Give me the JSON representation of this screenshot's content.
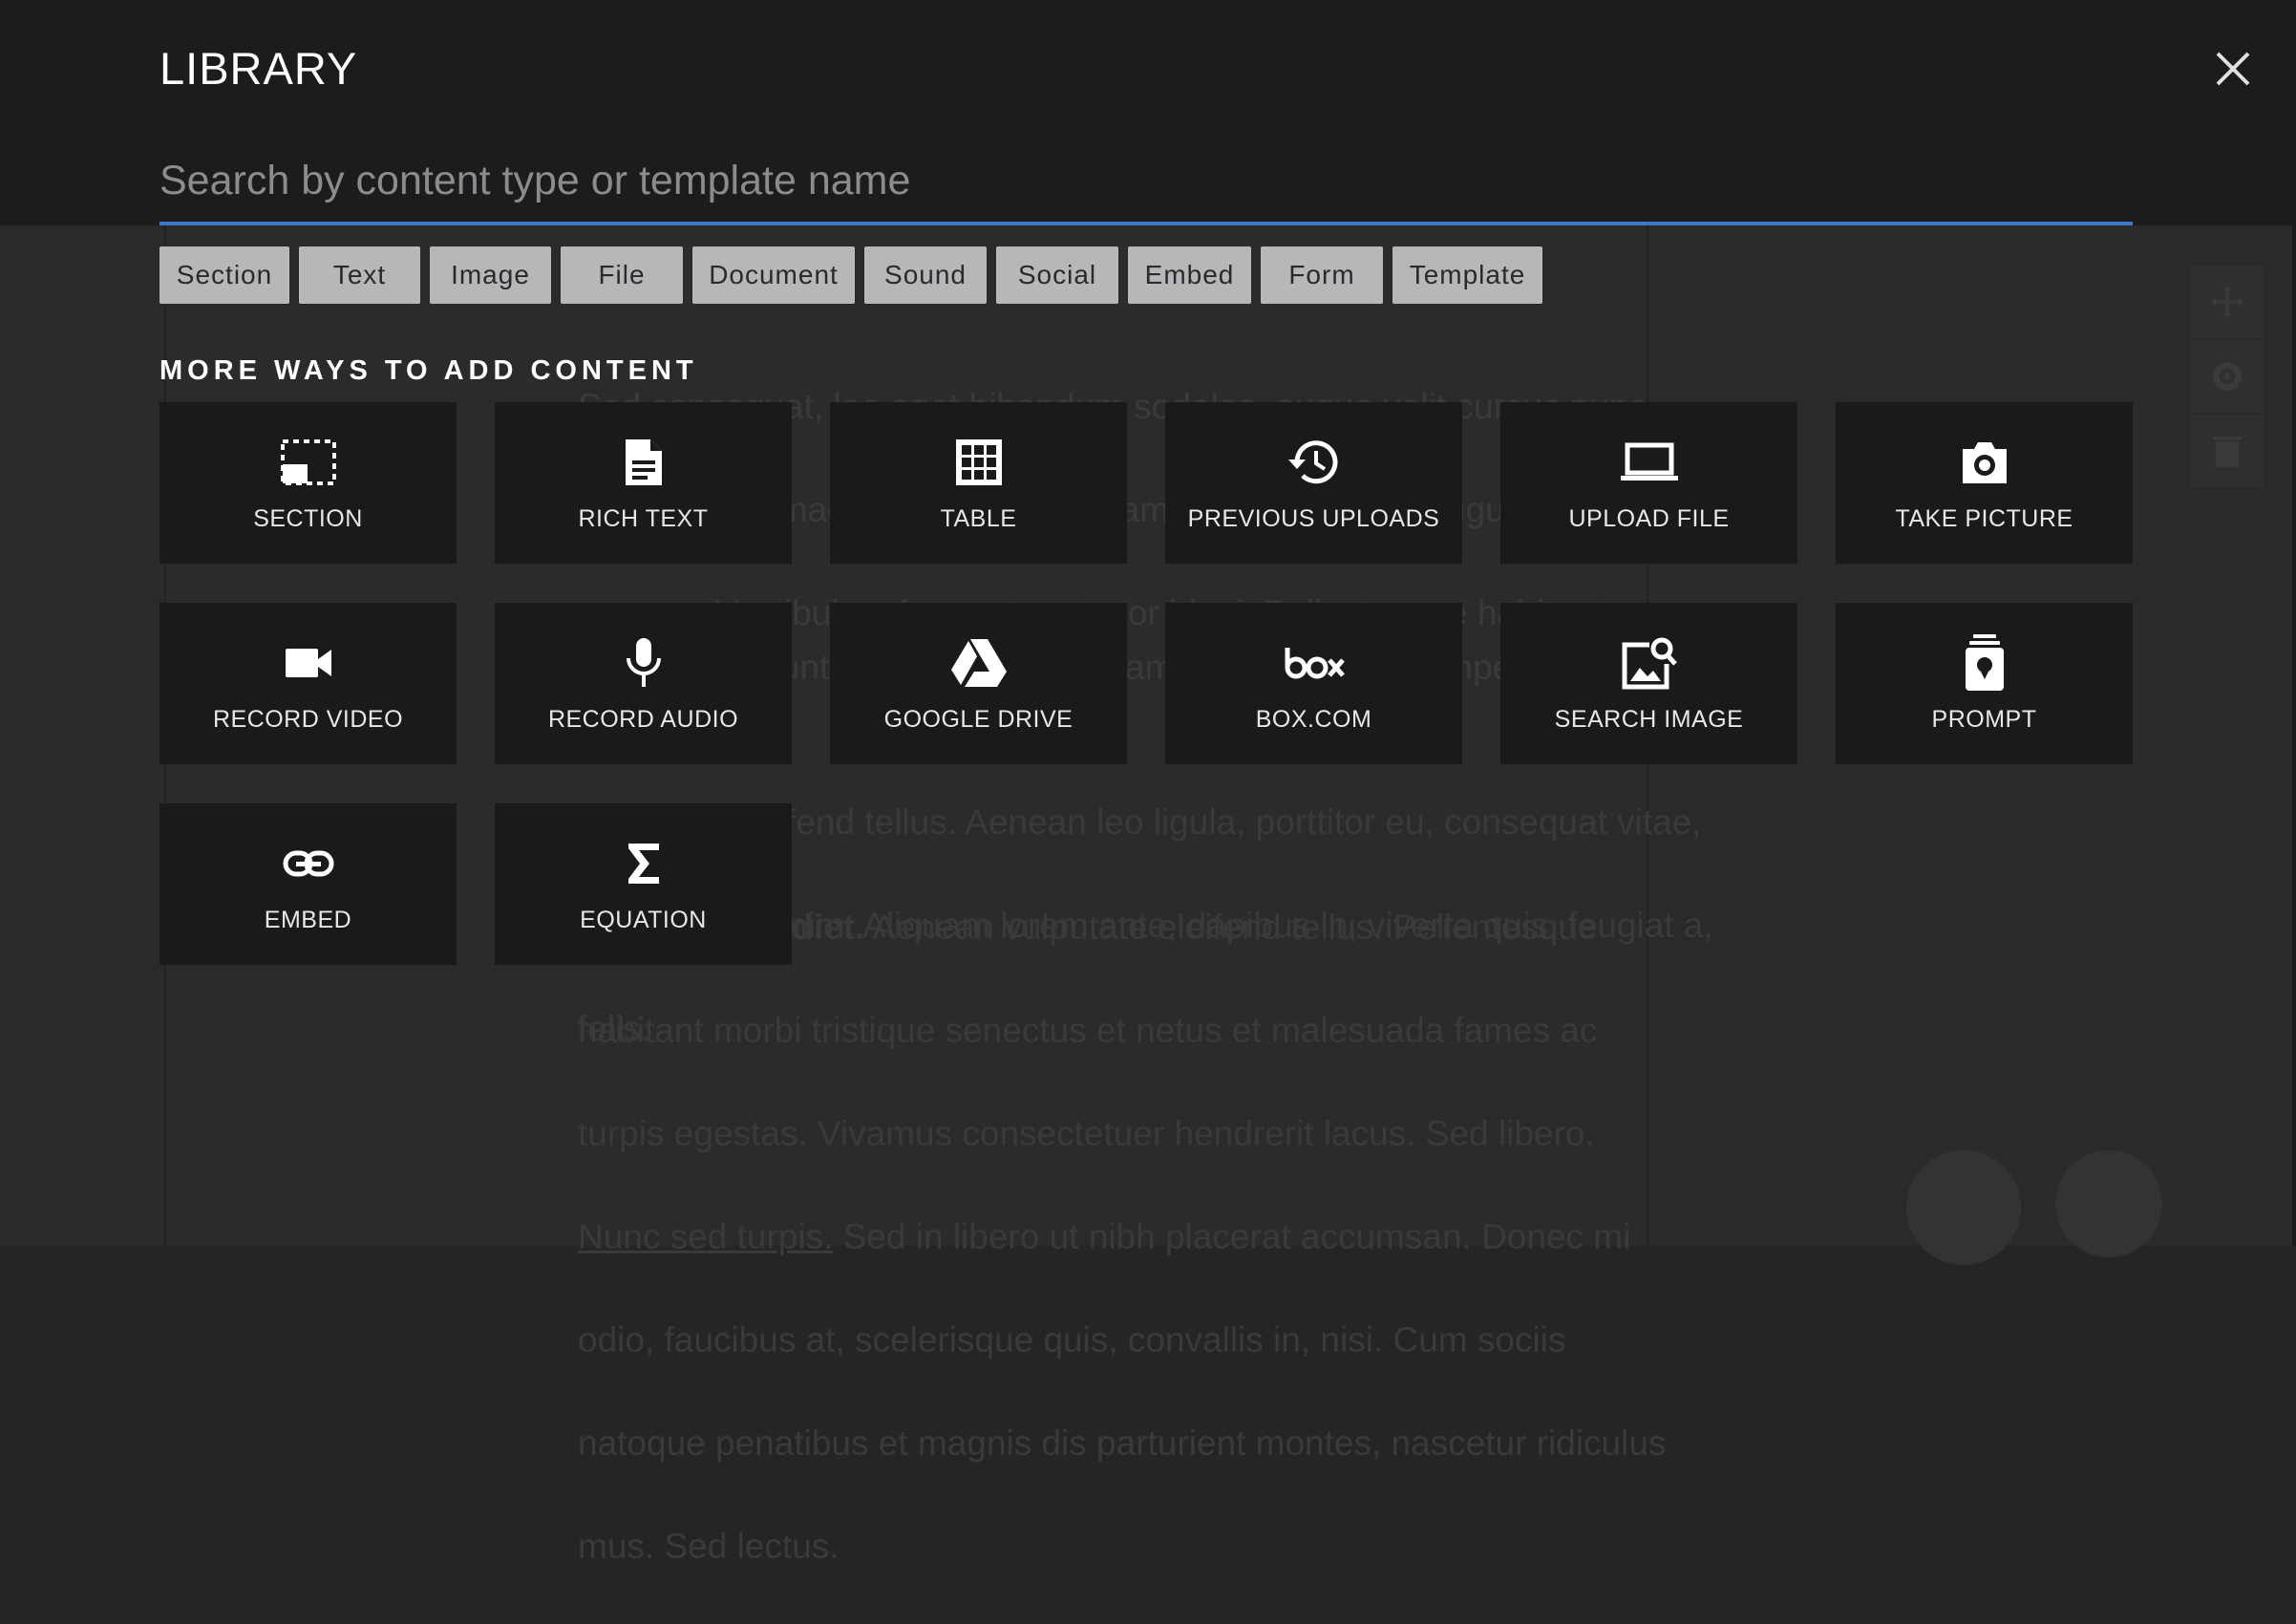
{
  "library": {
    "title": "LIBRARY",
    "search_placeholder": "Search by content type or template name",
    "close_icon": "close-icon"
  },
  "filters": [
    "Section",
    "Text",
    "Image",
    "File",
    "Document",
    "Sound",
    "Social",
    "Embed",
    "Form",
    "Template"
  ],
  "more_ways": {
    "heading": "MORE WAYS TO ADD CONTENT",
    "tiles": [
      {
        "label": "SECTION",
        "icon": "section-icon"
      },
      {
        "label": "RICH TEXT",
        "icon": "document-icon"
      },
      {
        "label": "TABLE",
        "icon": "table-icon"
      },
      {
        "label": "PREVIOUS UPLOADS",
        "icon": "history-icon"
      },
      {
        "label": "UPLOAD FILE",
        "icon": "laptop-icon"
      },
      {
        "label": "TAKE PICTURE",
        "icon": "camera-icon"
      },
      {
        "label": "RECORD VIDEO",
        "icon": "video-camera-icon"
      },
      {
        "label": "RECORD AUDIO",
        "icon": "microphone-icon"
      },
      {
        "label": "GOOGLE DRIVE",
        "icon": "google-drive-icon"
      },
      {
        "label": "BOX.COM",
        "icon": "box-logo-icon"
      },
      {
        "label": "SEARCH IMAGE",
        "icon": "image-search-icon"
      },
      {
        "label": "PROMPT",
        "icon": "prompt-icon"
      },
      {
        "label": "EMBED",
        "icon": "link-icon"
      },
      {
        "label": "EQUATION",
        "icon": "sigma-icon"
      }
    ]
  },
  "background_page": {
    "para1_lines": [
      "Sed consequat, leo eget bibendum sodales, augue velit cursus nunc,",
      "quis gravida magna mi a libero. Etiam ultricies nisi vel augue. Fusce",
      "a quam. Vestibulum fermentum tortor id mi. Pellentesque habitant"
    ],
    "para2_lines": [
      "Integer tincidunt. Cras dapibus. Vivamus elementum semper nisi. Aenean",
      "vulputate eleifend tellus. Aenean leo ligula, porttitor eu, consequat vitae,",
      "eleifend ac, enim. Aliquam lorem ante, dapibus in, viverra quis, feugiat a,",
      "felis."
    ],
    "bold_phrase": "Donec imperdiet.",
    "para3_first_rest": " Aenean vulputate eleifend tellus. Pellentesque",
    "para3_lines": [
      "habitant morbi tristique senectus et netus et malesuada fames ac",
      "turpis egestas. Vivamus consectetuer hendrerit lacus. Sed libero."
    ],
    "link_text": "Nunc sed turpis.",
    "para3_link_rest": " Sed in libero ut nibh placerat accumsan. Donec mi",
    "para3_tail": [
      "odio, faucibus at, scelerisque quis, convallis in, nisi. Cum sociis",
      "natoque penatibus et magnis dis parturient montes, nascetur ridiculus",
      "mus. Sed lectus."
    ]
  },
  "colors": {
    "accent": "#3b78c7",
    "header_bg": "#1c1c1e",
    "tile_bg": "#1a1a1b",
    "chip_bg": "#b7b7ba"
  }
}
